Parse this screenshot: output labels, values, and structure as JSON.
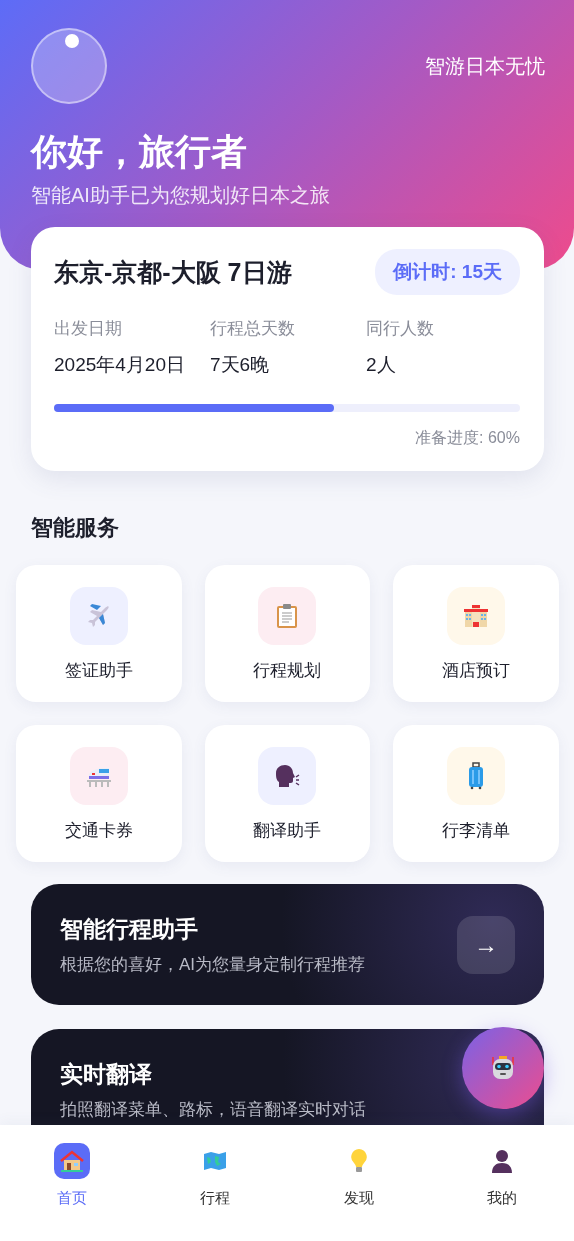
{
  "header": {
    "tagline": "智游日本无忧",
    "greeting": "你好，旅行者",
    "subtitle": "智能AI助手已为您规划好日本之旅"
  },
  "trip": {
    "title": "东京-京都-大阪 7日游",
    "countdown": "倒计时: 15天",
    "stats": [
      {
        "label": "出发日期",
        "value": "2025年4月20日"
      },
      {
        "label": "行程总天数",
        "value": "7天6晚"
      },
      {
        "label": "同行人数",
        "value": "2人"
      }
    ],
    "progress": {
      "level": 0.6,
      "reading": "准备进度: 60%"
    }
  },
  "services": {
    "title": "智能服务",
    "items": [
      {
        "label": "签证助手",
        "kind": "plane",
        "color": "#eef0ff"
      },
      {
        "label": "行程规划",
        "kind": "clipboard",
        "color": "#fdedf2"
      },
      {
        "label": "酒店预订",
        "kind": "hotel",
        "color": "#fff8ea"
      },
      {
        "label": "交通卡券",
        "kind": "train",
        "color": "#fdedf2"
      },
      {
        "label": "翻译助手",
        "kind": "speaker",
        "color": "#eef0ff"
      },
      {
        "label": "行李清单",
        "kind": "luggage",
        "color": "#fff8ea"
      }
    ]
  },
  "promos": [
    {
      "title": "智能行程助手",
      "text": "根据您的喜好，AI为您量身定制行程推荐",
      "arrow": "→"
    },
    {
      "title": "实时翻译",
      "text": "拍照翻译菜单、路标，语音翻译实时对话"
    }
  ],
  "tab_bar": [
    {
      "label": "首页",
      "kind": "house",
      "selected": true
    },
    {
      "label": "行程",
      "kind": "map",
      "selected": false
    },
    {
      "label": "发现",
      "kind": "bulb",
      "selected": false
    },
    {
      "label": "我的",
      "kind": "person",
      "selected": false
    }
  ]
}
